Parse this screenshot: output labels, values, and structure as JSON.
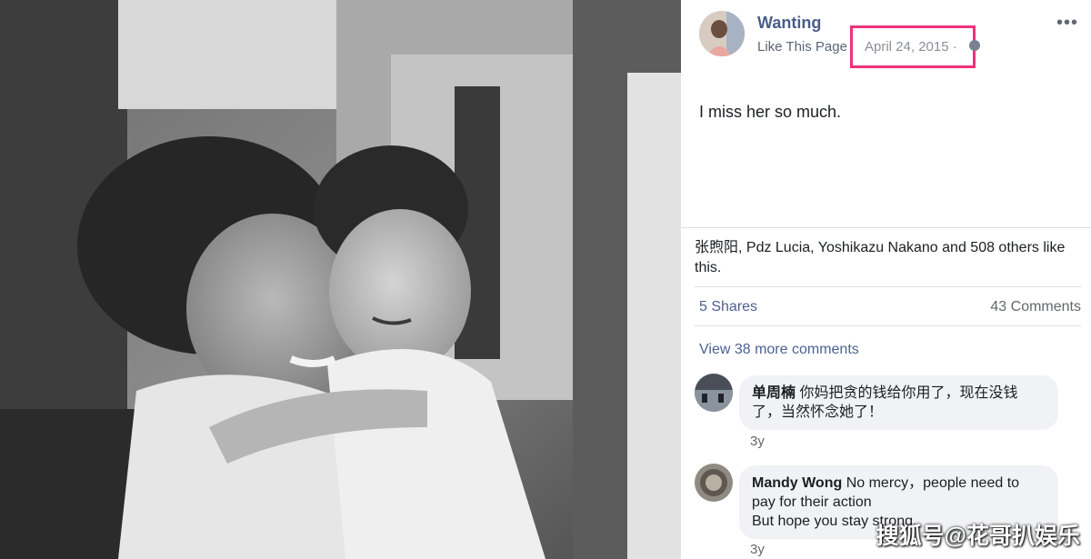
{
  "post": {
    "author": "Wanting",
    "like_page": "Like This Page",
    "date": "April 24, 2015 ·",
    "text": "I miss her so much.",
    "likes_text": "张煦阳, Pdz Lucia, Yoshikazu Nakano and 508 others like this.",
    "shares": "5 Shares",
    "comments_count": "43 Comments",
    "view_more": "View 38 more comments",
    "more_icon": "more-options-icon",
    "highlight_color": "#f0307b"
  },
  "comments": [
    {
      "name": "单周楠",
      "text": "你妈把贪的钱给你用了，现在没钱了，当然怀念她了！",
      "time": "3y"
    },
    {
      "name": "Mandy Wong",
      "text": "No mercy，people need to pay for their action",
      "text2": "But hope you stay strong.",
      "time": "3y"
    }
  ],
  "watermark": "搜狐号@花哥扒娱乐"
}
